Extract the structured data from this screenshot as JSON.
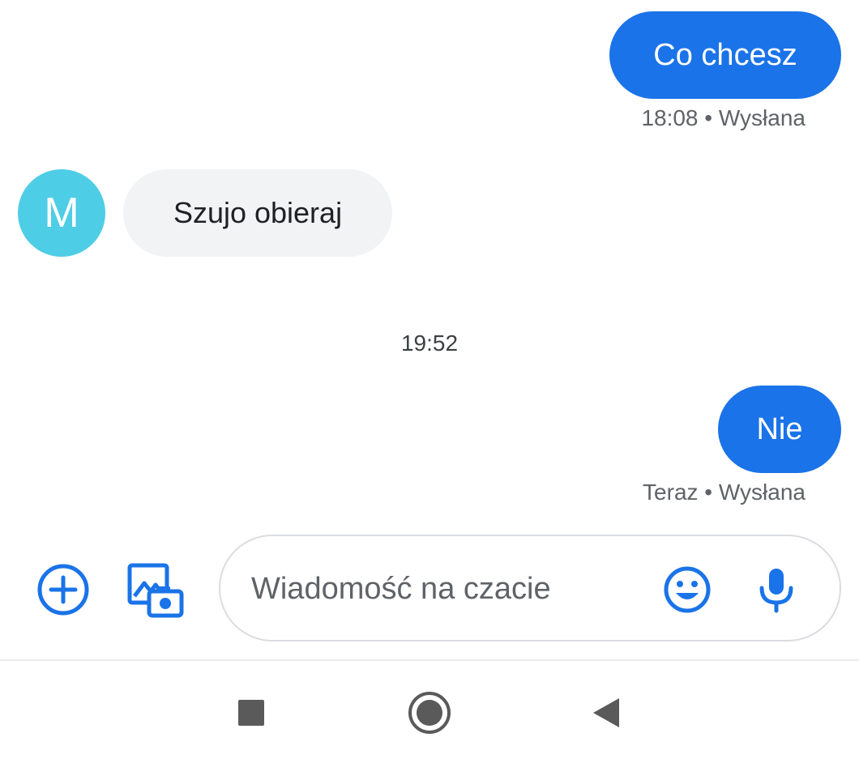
{
  "conversation": {
    "messages": [
      {
        "direction": "outgoing",
        "text": "Co chcesz",
        "meta": "18:08 • Wysłana"
      },
      {
        "direction": "incoming",
        "text": "Szujo obieraj",
        "avatar_letter": "M",
        "avatar_color": "#4ecde6"
      },
      {
        "direction": "outgoing",
        "text": "Nie",
        "meta": "Teraz • Wysłana"
      }
    ],
    "timestamp_separator": "19:52"
  },
  "compose": {
    "placeholder": "Wiadomość na czacie",
    "icons": [
      "add-icon",
      "gallery-camera-icon",
      "emoji-icon",
      "mic-icon"
    ]
  },
  "navbar": {
    "icons": [
      "recents-icon",
      "home-icon",
      "back-icon"
    ]
  },
  "colors": {
    "accent": "#1a73e8",
    "incoming_bubble": "#f1f3f4",
    "meta_text": "#5f6368"
  }
}
